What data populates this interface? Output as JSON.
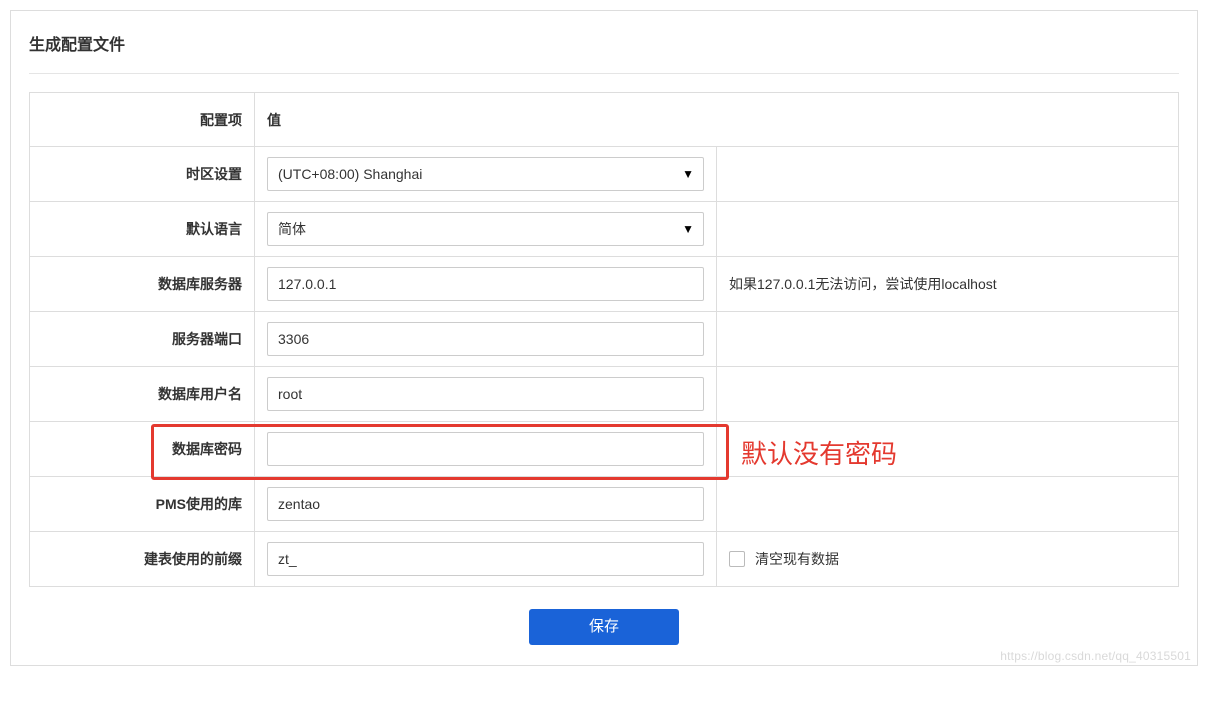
{
  "panel_title": "生成配置文件",
  "header": {
    "label": "配置项",
    "value": "值"
  },
  "rows": {
    "timezone": {
      "label": "时区设置",
      "value": "(UTC+08:00) Shanghai"
    },
    "language": {
      "label": "默认语言",
      "value": "简体"
    },
    "db_host": {
      "label": "数据库服务器",
      "value": "127.0.0.1",
      "hint": "如果127.0.0.1无法访问，尝试使用localhost"
    },
    "db_port": {
      "label": "服务器端口",
      "value": "3306"
    },
    "db_user": {
      "label": "数据库用户名",
      "value": "root"
    },
    "db_pass": {
      "label": "数据库密码",
      "value": ""
    },
    "db_name": {
      "label": "PMS使用的库",
      "value": "zentao"
    },
    "db_prefix": {
      "label": "建表使用的前缀",
      "value": "zt_",
      "clear_label": "清空现有数据"
    }
  },
  "save_button": "保存",
  "annotation": "默认没有密码",
  "watermark": "https://blog.csdn.net/qq_40315501"
}
